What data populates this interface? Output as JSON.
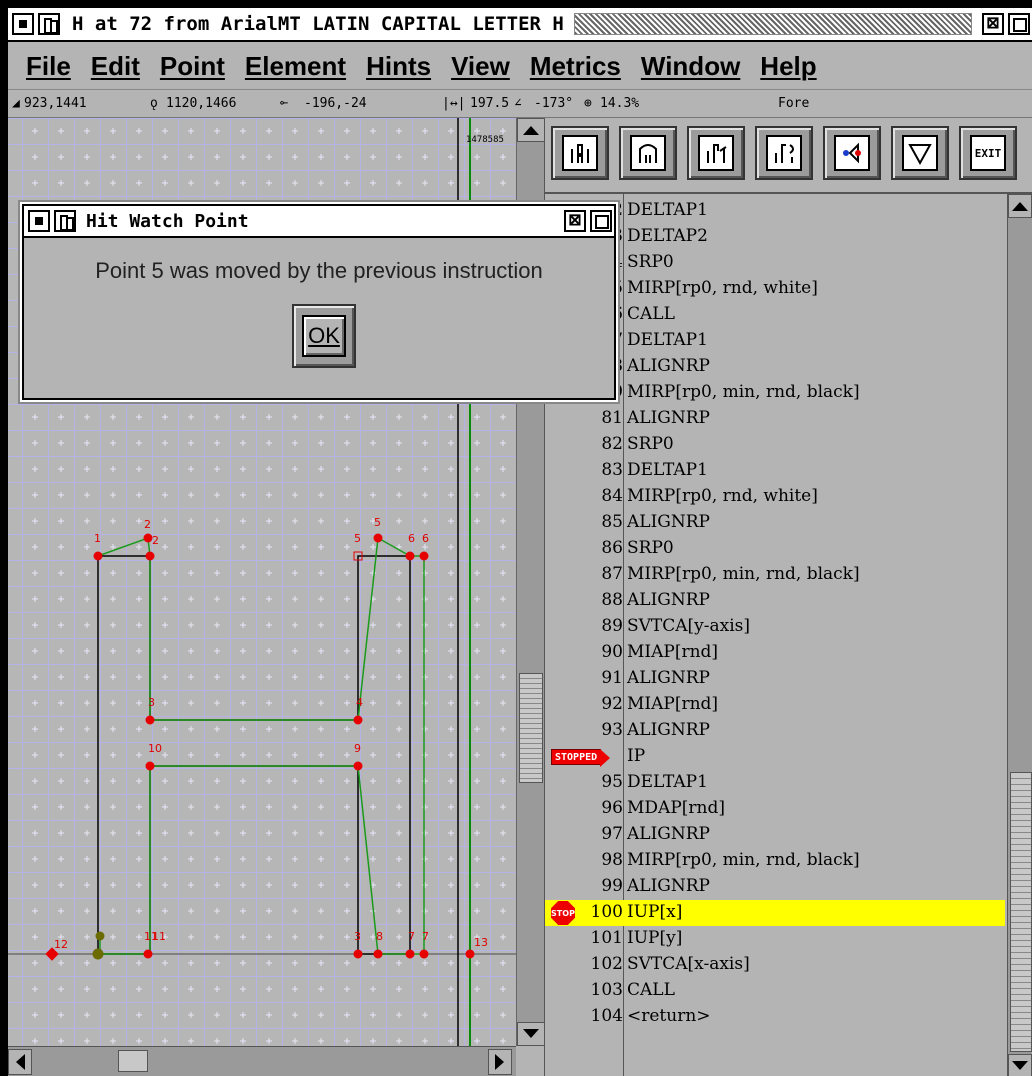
{
  "window": {
    "title": "H at 72 from ArialMT LATIN CAPITAL LETTER H"
  },
  "menu": [
    "File",
    "Edit",
    "Point",
    "Element",
    "Hints",
    "View",
    "Metrics",
    "Window",
    "Help"
  ],
  "infobar": {
    "cursor_pos": "923,1441",
    "point_pos": "1120,1466",
    "offset": "-196,-24",
    "distance": "197.5",
    "angle": "-173°",
    "zoom": "14.3%",
    "layer": "Fore"
  },
  "canvas": {
    "ruler_value": "1478585",
    "point_labels": [
      "1",
      "2",
      "2",
      "5",
      "5",
      "6",
      "6",
      "3",
      "4",
      "10",
      "9",
      "12",
      "11",
      "11",
      "3",
      "8",
      "7",
      "7",
      "13"
    ]
  },
  "toolbar": {
    "buttons": [
      "step-into",
      "step-over",
      "step-out",
      "continue",
      "watch-point",
      "down",
      "exit"
    ],
    "exit_label": "EXIT"
  },
  "code": {
    "rows": [
      {
        "num": "72",
        "ins": "DELTAP1"
      },
      {
        "num": "73",
        "ins": "DELTAP2"
      },
      {
        "num": "74",
        "ins": "SRP0"
      },
      {
        "num": "75",
        "ins": "MIRP[rp0, rnd, white]"
      },
      {
        "num": "76",
        "ins": "CALL"
      },
      {
        "num": "77",
        "ins": "DELTAP1"
      },
      {
        "num": "78",
        "ins": "ALIGNRP"
      },
      {
        "num": "79",
        "ins": "MIRP[rp0, min, rnd, black]"
      },
      {
        "num": "81",
        "ins": "ALIGNRP"
      },
      {
        "num": "82",
        "ins": "SRP0"
      },
      {
        "num": "83",
        "ins": "DELTAP1"
      },
      {
        "num": "84",
        "ins": "MIRP[rp0, rnd, white]"
      },
      {
        "num": "85",
        "ins": "ALIGNRP"
      },
      {
        "num": "86",
        "ins": "SRP0"
      },
      {
        "num": "87",
        "ins": "MIRP[rp0, min, rnd, black]"
      },
      {
        "num": "88",
        "ins": "ALIGNRP"
      },
      {
        "num": "89",
        "ins": "SVTCA[y-axis]"
      },
      {
        "num": "90",
        "ins": "MIAP[rnd]"
      },
      {
        "num": "91",
        "ins": "ALIGNRP"
      },
      {
        "num": "92",
        "ins": "MIAP[rnd]"
      },
      {
        "num": "93",
        "ins": "ALIGNRP"
      },
      {
        "num": "94",
        "ins": "IP"
      },
      {
        "num": "95",
        "ins": "DELTAP1"
      },
      {
        "num": "96",
        "ins": "MDAP[rnd]"
      },
      {
        "num": "97",
        "ins": "ALIGNRP"
      },
      {
        "num": "98",
        "ins": "MIRP[rp0, min, rnd, black]"
      },
      {
        "num": "99",
        "ins": "ALIGNRP"
      },
      {
        "num": "100",
        "ins": "IUP[x]"
      },
      {
        "num": "101",
        "ins": "IUP[y]"
      },
      {
        "num": "102",
        "ins": "SVTCA[x-axis]"
      },
      {
        "num": "103",
        "ins": "CALL"
      },
      {
        "num": "104",
        "ins": "<return>"
      }
    ],
    "stopped_label": "STOPPED",
    "stop_label": "STOP",
    "highlight_color": "#ffff00"
  },
  "dialog": {
    "title": "Hit Watch Point",
    "message": "Point 5 was moved by the previous instruction",
    "ok_label": "OK"
  }
}
